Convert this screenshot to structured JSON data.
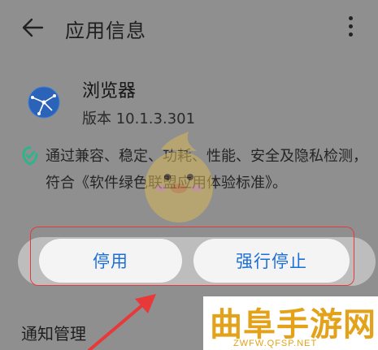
{
  "header": {
    "title": "应用信息",
    "back_icon": "arrow-left-icon",
    "more_icon": "more-vertical-icon"
  },
  "app": {
    "name": "浏览器",
    "version": "版本 10.1.3.301",
    "icon": "globe-icon"
  },
  "certification": {
    "icon": "shield-check-icon",
    "text": "通过兼容、稳定、功耗、性能、安全及隐私检测，符合《软件绿色联盟应用体验标准》。"
  },
  "buttons": {
    "disable": "停用",
    "force_stop": "强行停止"
  },
  "sections": {
    "notifications": "通知管理"
  },
  "watermark": {
    "title": "曲阜手游网",
    "url": "ZWFW.QFSP.NET"
  },
  "colors": {
    "accent": "#1d6fd6",
    "highlight": "#e8393a",
    "watermark": "#e3a21a"
  }
}
